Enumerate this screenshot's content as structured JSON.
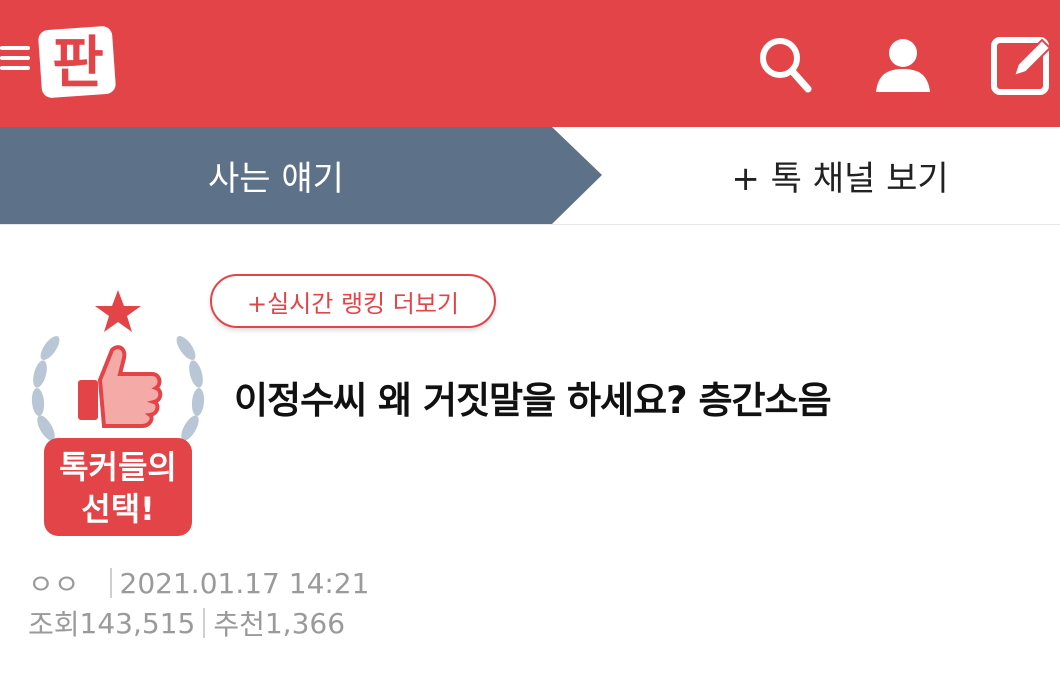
{
  "header": {
    "logo_text": "판",
    "colors": {
      "brand": "#e34448",
      "nav_active": "#5d7189"
    },
    "icons": [
      "menu-icon",
      "search-icon",
      "user-icon",
      "write-icon"
    ]
  },
  "subnav": {
    "current_label": "사는 얘기",
    "channel_more_label": "+ 톡 채널 보기"
  },
  "post": {
    "badge_line1": "톡커들의",
    "badge_line2": "선택!",
    "ranking_link": "+실시간 랭킹 더보기",
    "title": "이정수씨 왜 거짓말을 하세요? 층간소음",
    "author": "ㅇㅇ",
    "datetime": "2021.01.17 14:21",
    "views_label": "조회",
    "views": "143,515",
    "recommend_label": "추천",
    "recommend": "1,366"
  }
}
